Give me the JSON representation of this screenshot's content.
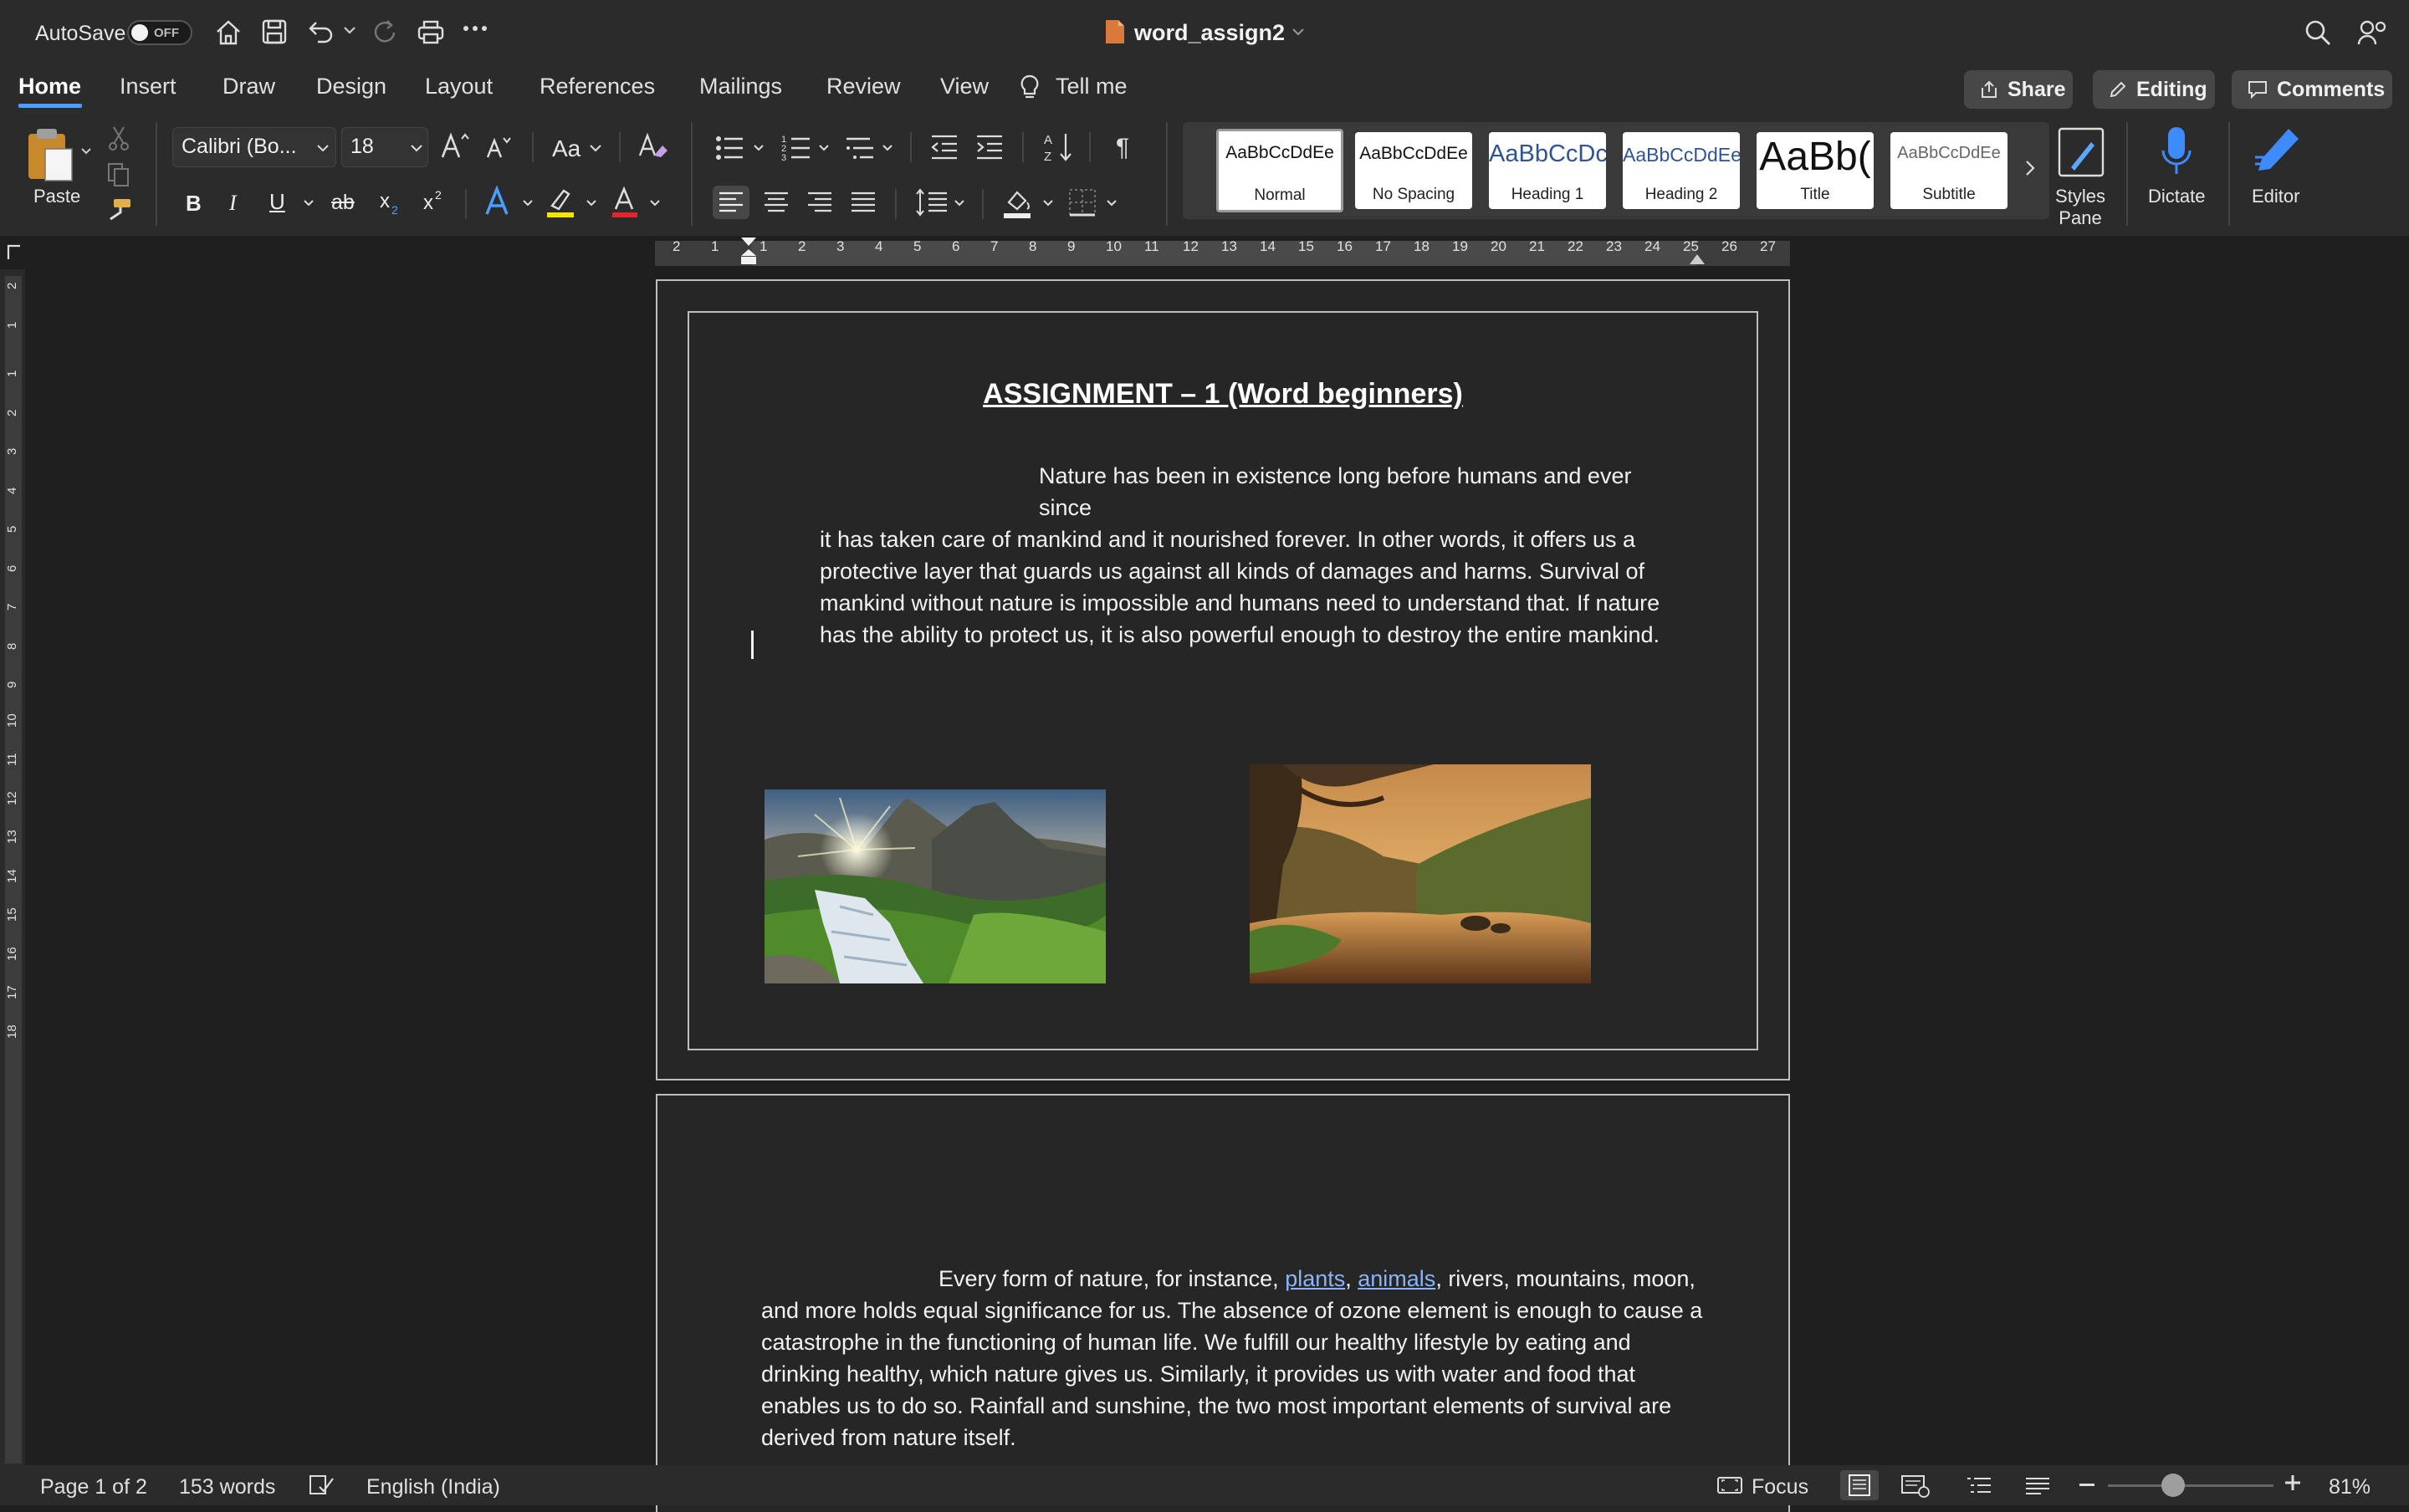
{
  "titlebar": {
    "autosave_label": "AutoSave",
    "autosave_state": "OFF",
    "doc_title": "word_assign2"
  },
  "ribbon": {
    "tabs": [
      "Home",
      "Insert",
      "Draw",
      "Design",
      "Layout",
      "References",
      "Mailings",
      "Review",
      "View"
    ],
    "tell_me": "Tell me",
    "share": "Share",
    "editing": "Editing",
    "comments": "Comments",
    "paste": "Paste",
    "font_name": "Calibri (Bo...",
    "font_size": "18",
    "change_case": "Aa",
    "styles": [
      {
        "preview": "AaBbCcDdEe",
        "name": "Normal"
      },
      {
        "preview": "AaBbCcDdEe",
        "name": "No Spacing"
      },
      {
        "preview": "AaBbCcDc",
        "name": "Heading 1"
      },
      {
        "preview": "AaBbCcDdEe",
        "name": "Heading 2"
      },
      {
        "preview": "AaBb(",
        "name": "Title"
      },
      {
        "preview": "AaBbCcDdEe",
        "name": "Subtitle"
      }
    ],
    "styles_pane": "Styles Pane",
    "dictate": "Dictate",
    "editor": "Editor",
    "accent_color": "#4a9eff"
  },
  "ruler": {
    "numbers": [
      "2",
      "1",
      "1",
      "2",
      "3",
      "4",
      "5",
      "6",
      "7",
      "8",
      "9",
      "10",
      "11",
      "12",
      "13",
      "14",
      "15",
      "16",
      "17",
      "18",
      "19",
      "20",
      "21",
      "22",
      "23",
      "24",
      "25",
      "26",
      "27"
    ]
  },
  "vruler": {
    "numbers": [
      "2",
      "1",
      "1",
      "2",
      "3",
      "4",
      "5",
      "6",
      "7",
      "8",
      "9",
      "10",
      "11",
      "12",
      "13",
      "14",
      "15",
      "16",
      "17",
      "18"
    ]
  },
  "document": {
    "title": "ASSIGNMENT – 1 (Word beginners)",
    "para1_lines": [
      "Nature has been in existence long before humans and ever since",
      "it has taken care of mankind and it nourished forever. In other words, it offers us a",
      "protective layer that guards us against all kinds of damages and harms. Survival of",
      "mankind without nature is impossible and humans need to understand that. If nature",
      "has the ability to protect us, it is also powerful enough to destroy the entire mankind."
    ],
    "para2_line1_pre": "Every form of nature, for instance, ",
    "link1": "plants",
    "comma": ", ",
    "link2": "animals",
    "para2_line1_post": ", rivers, mountains, moon,",
    "para2_lines": [
      "and more holds equal significance for us.  The absence of ozone element is enough to cause a",
      "catastrophe in the functioning of human life. We fulfill our healthy lifestyle by eating and",
      "drinking healthy, which nature gives us. Similarly, it provides us with water and food that",
      "enables us to do so. Rainfall and sunshine, the two most important elements of survival are",
      "derived from nature itself."
    ]
  },
  "status": {
    "page": "Page 1 of 2",
    "words": "153 words",
    "language": "English (India)",
    "focus": "Focus",
    "zoom": "81%"
  }
}
